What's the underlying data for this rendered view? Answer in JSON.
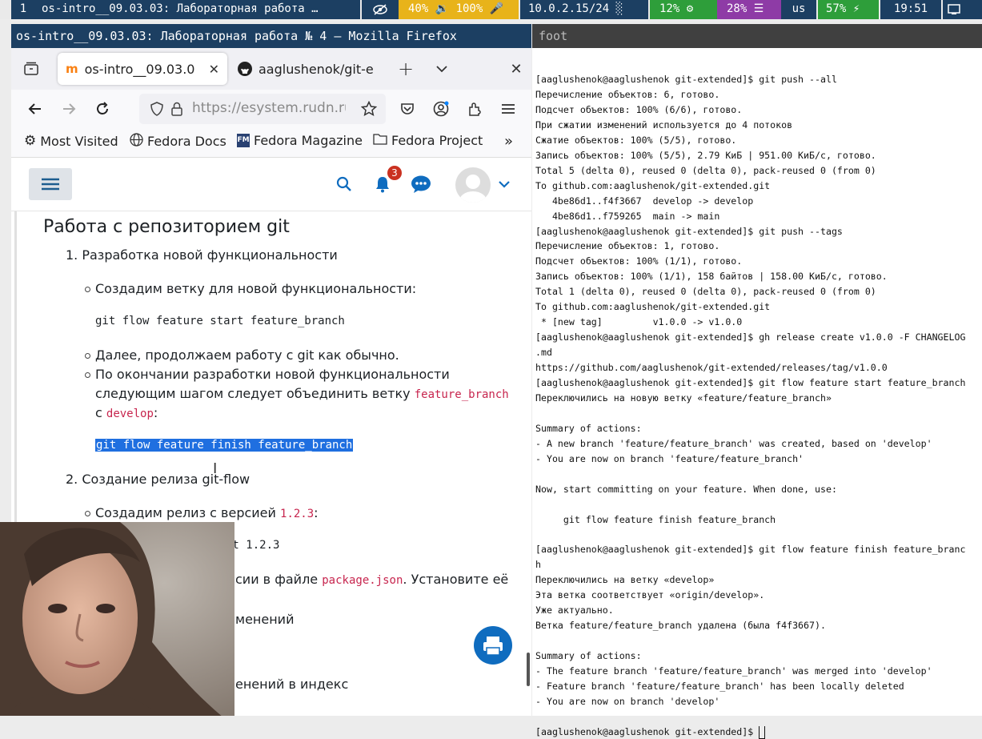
{
  "topbar": {
    "workspace": "1",
    "window_title": "os-intro__09.03.03: Лабораторная работа …",
    "audio": "40% 🔉 100% 🎤",
    "network": "10.0.2.15/24 ░",
    "cpu": "12% ⚙",
    "memory": "28% ☰",
    "lang": "us",
    "battery": "57% ⚡",
    "clock": "19:51"
  },
  "firefox": {
    "window_title": "os-intro__09.03.03: Лабораторная работа № 4 — Mozilla Firefox",
    "tabs": [
      {
        "label": "os-intro__09.03.0"
      },
      {
        "label": "aaglushenok/git-e"
      }
    ],
    "url": "https://esystem.rudn.ru",
    "bookmarks": [
      "Most Visited",
      "Fedora Docs",
      "Fedora Magazine",
      "Fedora Project"
    ],
    "notification_count": "3"
  },
  "page": {
    "heading": "Работа с репозиторием git",
    "item1": "1. Разработка новой функциональности",
    "b1": "Создадим ветку для новой функциональности:",
    "code1": "git flow feature start feature_branch",
    "b2": "Далее, продолжаем работу с git как обычно.",
    "b3_line1": "По окончании разработки новой функциональности",
    "b3_line2": "следующим шагом следует объединить ветку",
    "b3_code1": "feature_branch",
    "b3_c": "с",
    "b3_code2": "develop",
    "b3_colon": ":",
    "code2": "git flow feature finish feature_branch",
    "item2": "2. Создание релиза git-flow",
    "b4": "Создадим релиз с версией",
    "b4_code": "1.2.3",
    "b4_colon": ":",
    "code3_tail": "rt 1.2.3",
    "line_version_tail": "сии в файле",
    "line_version_code": "package.json",
    "line_version_end": ". Установите её",
    "line_changes_tail": "менений",
    "line_index_tail": "енений в индекс"
  },
  "terminal": {
    "title": "foot",
    "lines": [
      "[aaglushenok@aaglushenok git-extended]$ git push --all",
      "Перечисление объектов: 6, готово.",
      "Подсчет объектов: 100% (6/6), готово.",
      "При сжатии изменений используется до 4 потоков",
      "Сжатие объектов: 100% (5/5), готово.",
      "Запись объектов: 100% (5/5), 2.79 КиБ | 951.00 КиБ/с, готово.",
      "Total 5 (delta 0), reused 0 (delta 0), pack-reused 0 (from 0)",
      "To github.com:aaglushenok/git-extended.git",
      "   4be86d1..f4f3667  develop -> develop",
      "   4be86d1..f759265  main -> main",
      "[aaglushenok@aaglushenok git-extended]$ git push --tags",
      "Перечисление объектов: 1, готово.",
      "Подсчет объектов: 100% (1/1), готово.",
      "Запись объектов: 100% (1/1), 158 байтов | 158.00 КиБ/с, готово.",
      "Total 1 (delta 0), reused 0 (delta 0), pack-reused 0 (from 0)",
      "To github.com:aaglushenok/git-extended.git",
      " * [new tag]         v1.0.0 -> v1.0.0",
      "[aaglushenok@aaglushenok git-extended]$ gh release create v1.0.0 -F CHANGELOG",
      ".md",
      "https://github.com/aaglushenok/git-extended/releases/tag/v1.0.0",
      "[aaglushenok@aaglushenok git-extended]$ git flow feature start feature_branch",
      "Переключились на новую ветку «feature/feature_branch»",
      "",
      "Summary of actions:",
      "- A new branch 'feature/feature_branch' was created, based on 'develop'",
      "- You are now on branch 'feature/feature_branch'",
      "",
      "Now, start committing on your feature. When done, use:",
      "",
      "     git flow feature finish feature_branch",
      "",
      "[aaglushenok@aaglushenok git-extended]$ git flow feature finish feature_branc",
      "h",
      "Переключились на ветку «develop»",
      "Эта ветка соответствует «origin/develop».",
      "Уже актуально.",
      "Ветка feature/feature_branch удалена (была f4f3667).",
      "",
      "Summary of actions:",
      "- The feature branch 'feature/feature_branch' was merged into 'develop'",
      "- Feature branch 'feature/feature_branch' has been locally deleted",
      "- You are now on branch 'develop'",
      "",
      "[aaglushenok@aaglushenok git-extended]$ "
    ]
  }
}
